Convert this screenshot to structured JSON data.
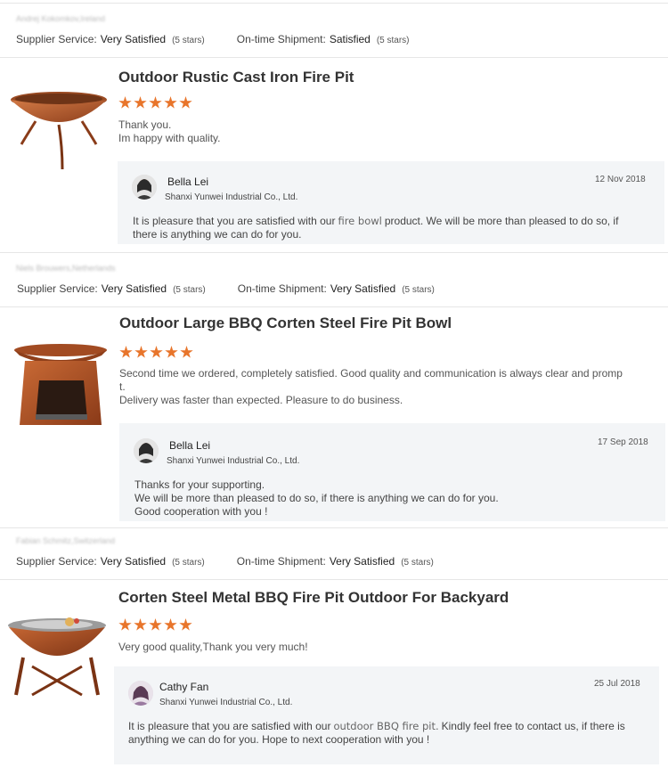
{
  "labels": {
    "supplier_service": "Supplier Service:",
    "on_time_shipment": "On-time Shipment:"
  },
  "reviews": [
    {
      "reviewer": "Andrej Kokomkov,Ireland",
      "supplier_service_value": "Very Satisfied",
      "supplier_service_stars": "(5 stars)",
      "shipment_value": "Satisfied",
      "shipment_stars": "(5 stars)",
      "product_title": "Outdoor Rustic Cast Iron Fire Pit",
      "rating": 5,
      "comment_lines": [
        "Thank you.",
        "Im happy with quality."
      ],
      "reply": {
        "name": "Bella Lei",
        "company": "Shanxi Yunwei Industrial Co., Ltd.",
        "date": "12 Nov 2018",
        "text_before": "It is pleasure that you are satisfied with our",
        "keyword": "fire bowl",
        "text_after": "product. We will be more than pleased to do so, if there is anything we can do for you."
      }
    },
    {
      "reviewer": "Niels Brouwers,Netherlands",
      "supplier_service_value": "Very Satisfied",
      "supplier_service_stars": "(5 stars)",
      "shipment_value": "Very Satisfied",
      "shipment_stars": "(5 stars)",
      "product_title": "Outdoor Large BBQ Corten Steel Fire Pit Bowl",
      "rating": 5,
      "comment_lines": [
        "Second time we ordered, completely satisfied. Good quality and communication is always clear and promp",
        "t.",
        "Delivery was faster than expected. Pleasure to do business."
      ],
      "reply": {
        "name": "Bella Lei",
        "company": "Shanxi Yunwei Industrial Co., Ltd.",
        "date": "17 Sep 2018",
        "text_lines": [
          "Thanks for your supporting.",
          "We will be more than pleased to do so, if there is anything we can do for you.",
          "Good cooperation with you !"
        ]
      }
    },
    {
      "reviewer": "Fabian Schmitz,Switzerland",
      "supplier_service_value": "Very Satisfied",
      "supplier_service_stars": "(5 stars)",
      "shipment_value": "Very Satisfied",
      "shipment_stars": "(5 stars)",
      "product_title": "Corten Steel Metal BBQ Fire Pit Outdoor For Backyard",
      "rating": 5,
      "comment_lines": [
        "Very good quality,Thank you very much!"
      ],
      "reply": {
        "name": "Cathy Fan",
        "company": "Shanxi Yunwei Industrial Co., Ltd.",
        "date": "25 Jul 2018",
        "text_before": "It is pleasure that you are satisfied with our",
        "keyword": "outdoor BBQ fire pit.",
        "text_after": "Kindly feel free to contact us, if there is anything we can do for you. Hope to next cooperation with you !"
      }
    }
  ],
  "colors": {
    "star": "#e8752b",
    "reply_bg": "#f3f5f7",
    "rust": "#b5582a"
  }
}
